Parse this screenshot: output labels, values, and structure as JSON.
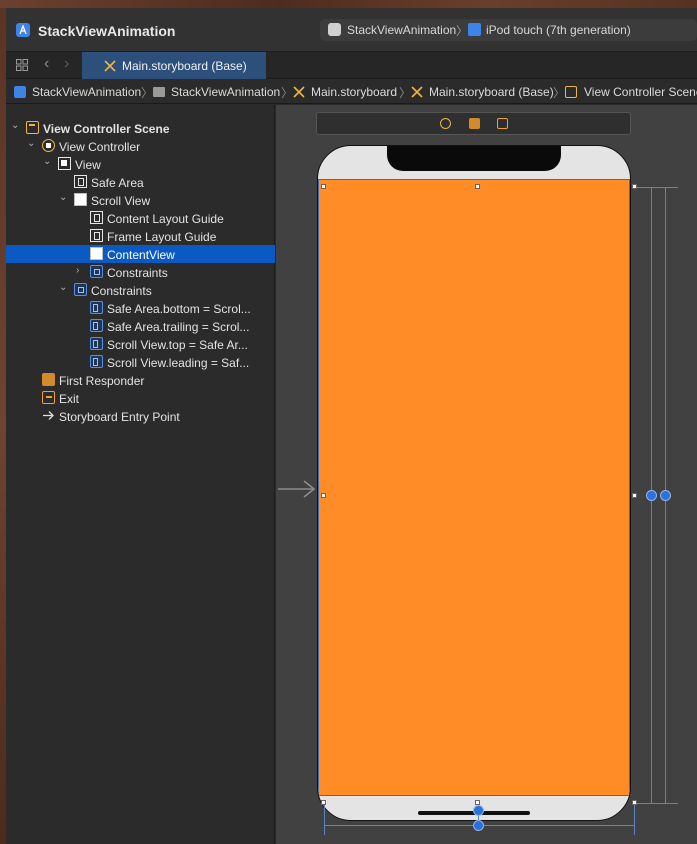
{
  "window": {
    "app_title": "StackViewAnimation",
    "scheme": {
      "target": "StackViewAnimation",
      "separator": "〉",
      "device": "iPod touch (7th generation)"
    }
  },
  "tabs": {
    "back_glyph": "‹",
    "forward_glyph": "›",
    "active_label": "Main.storyboard (Base)"
  },
  "breadcrumb": [
    "StackViewAnimation",
    "StackViewAnimation",
    "Main.storyboard",
    "Main.storyboard (Base)",
    "View Controller Scene"
  ],
  "breadcrumb_separator": "〉",
  "outline": [
    {
      "label": "View Controller Scene",
      "icon": "scene-icon",
      "bold": true
    },
    {
      "label": "View Controller",
      "icon": "view-controller-icon"
    },
    {
      "label": "View",
      "icon": "view-icon"
    },
    {
      "label": "Safe Area",
      "icon": "layout-guide-icon"
    },
    {
      "label": "Scroll View",
      "icon": "scroll-view-icon"
    },
    {
      "label": "Content Layout Guide",
      "icon": "layout-guide-icon"
    },
    {
      "label": "Frame Layout Guide",
      "icon": "layout-guide-icon"
    },
    {
      "label": "ContentView",
      "icon": "view-icon",
      "selected": true
    },
    {
      "label": "Constraints",
      "icon": "constraints-icon"
    },
    {
      "label": "Constraints",
      "icon": "constraints-icon"
    },
    {
      "label": "Safe Area.bottom = Scrol...",
      "icon": "constraint-icon"
    },
    {
      "label": "Safe Area.trailing = Scrol...",
      "icon": "constraint-icon"
    },
    {
      "label": "Scroll View.top = Safe Ar...",
      "icon": "constraint-icon"
    },
    {
      "label": "Scroll View.leading = Saf...",
      "icon": "constraint-icon"
    },
    {
      "label": "First Responder",
      "icon": "first-responder-icon"
    },
    {
      "label": "Exit",
      "icon": "exit-icon"
    },
    {
      "label": "Storyboard Entry Point",
      "icon": "arrow-right-icon"
    }
  ],
  "colors": {
    "selection": "#0b59c2",
    "scroll_view_fill": "#ff8c26",
    "accent": "#3d84e6"
  }
}
